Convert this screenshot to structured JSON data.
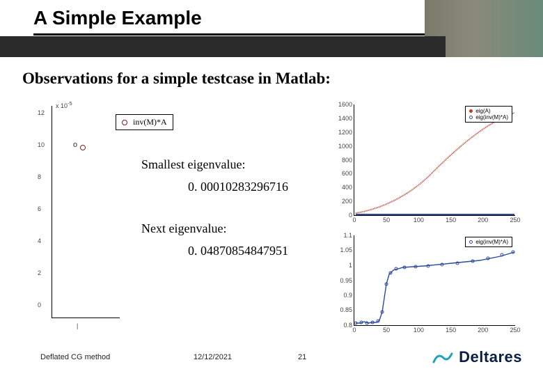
{
  "title": "A Simple Example",
  "subtitle": "Observations for a simple testcase in Matlab:",
  "legend": {
    "label": "inv(M)*A"
  },
  "eig1": {
    "label": "Smallest eigenvalue:",
    "value": "0. 00010283296716"
  },
  "eig2": {
    "label": "Next eigenvalue:",
    "value": "0. 04870854847951"
  },
  "leftchart": {
    "exp_label": "x 10",
    "exp_sup": "-5",
    "yticks": [
      "12",
      "10",
      "8",
      "6",
      "4",
      "2",
      "0"
    ],
    "btick": "|"
  },
  "topright": {
    "legend": [
      "eig(A)",
      "eig(inv(M)*A)"
    ],
    "yticks": [
      "1600",
      "1400",
      "1200",
      "1000",
      "800",
      "600",
      "400",
      "200",
      "0"
    ],
    "xticks": [
      "0",
      "50",
      "100",
      "150",
      "200",
      "250"
    ]
  },
  "botright": {
    "legend": [
      "eig(inv(M)*A)"
    ],
    "yticks": [
      "1.1",
      "1.05",
      "1",
      "0.95",
      "0.9",
      "0.85",
      "0.8"
    ],
    "xticks": [
      "0",
      "50",
      "100",
      "150",
      "200",
      "250"
    ]
  },
  "footer": {
    "method": "Deflated CG method",
    "date": "12/12/2021",
    "page": "21",
    "brand": "Deltares"
  },
  "chart_data": [
    {
      "type": "scatter",
      "id": "left",
      "title": "inv(M)*A small eigenvalue",
      "x": [
        1
      ],
      "y": [
        0.000103
      ],
      "ylim": [
        0,
        0.00013
      ],
      "legend": "inv(M)*A"
    },
    {
      "type": "line",
      "id": "top_right",
      "xlim": [
        0,
        260
      ],
      "ylim": [
        0,
        1600
      ],
      "series": [
        {
          "name": "eig(A)",
          "color": "#c0392b",
          "approx": "monotone increasing curve from ~40 at x=0 to ~1450 at x=260"
        },
        {
          "name": "eig(inv(M)*A)",
          "color": "#2b4a9a",
          "approx": "flat near y≈1 across full x-range (appears on x-axis at this scale)"
        }
      ]
    },
    {
      "type": "scatter",
      "id": "bottom_right",
      "xlim": [
        0,
        260
      ],
      "ylim": [
        0.8,
        1.1
      ],
      "series": [
        {
          "name": "eig(inv(M)*A)",
          "color": "#2b4a9a",
          "approx": "clustered near 0.81 for x<50, rises to ~0.98 by x≈60, then plateau ~1.0 with slight upward drift to 1.05"
        }
      ]
    }
  ]
}
